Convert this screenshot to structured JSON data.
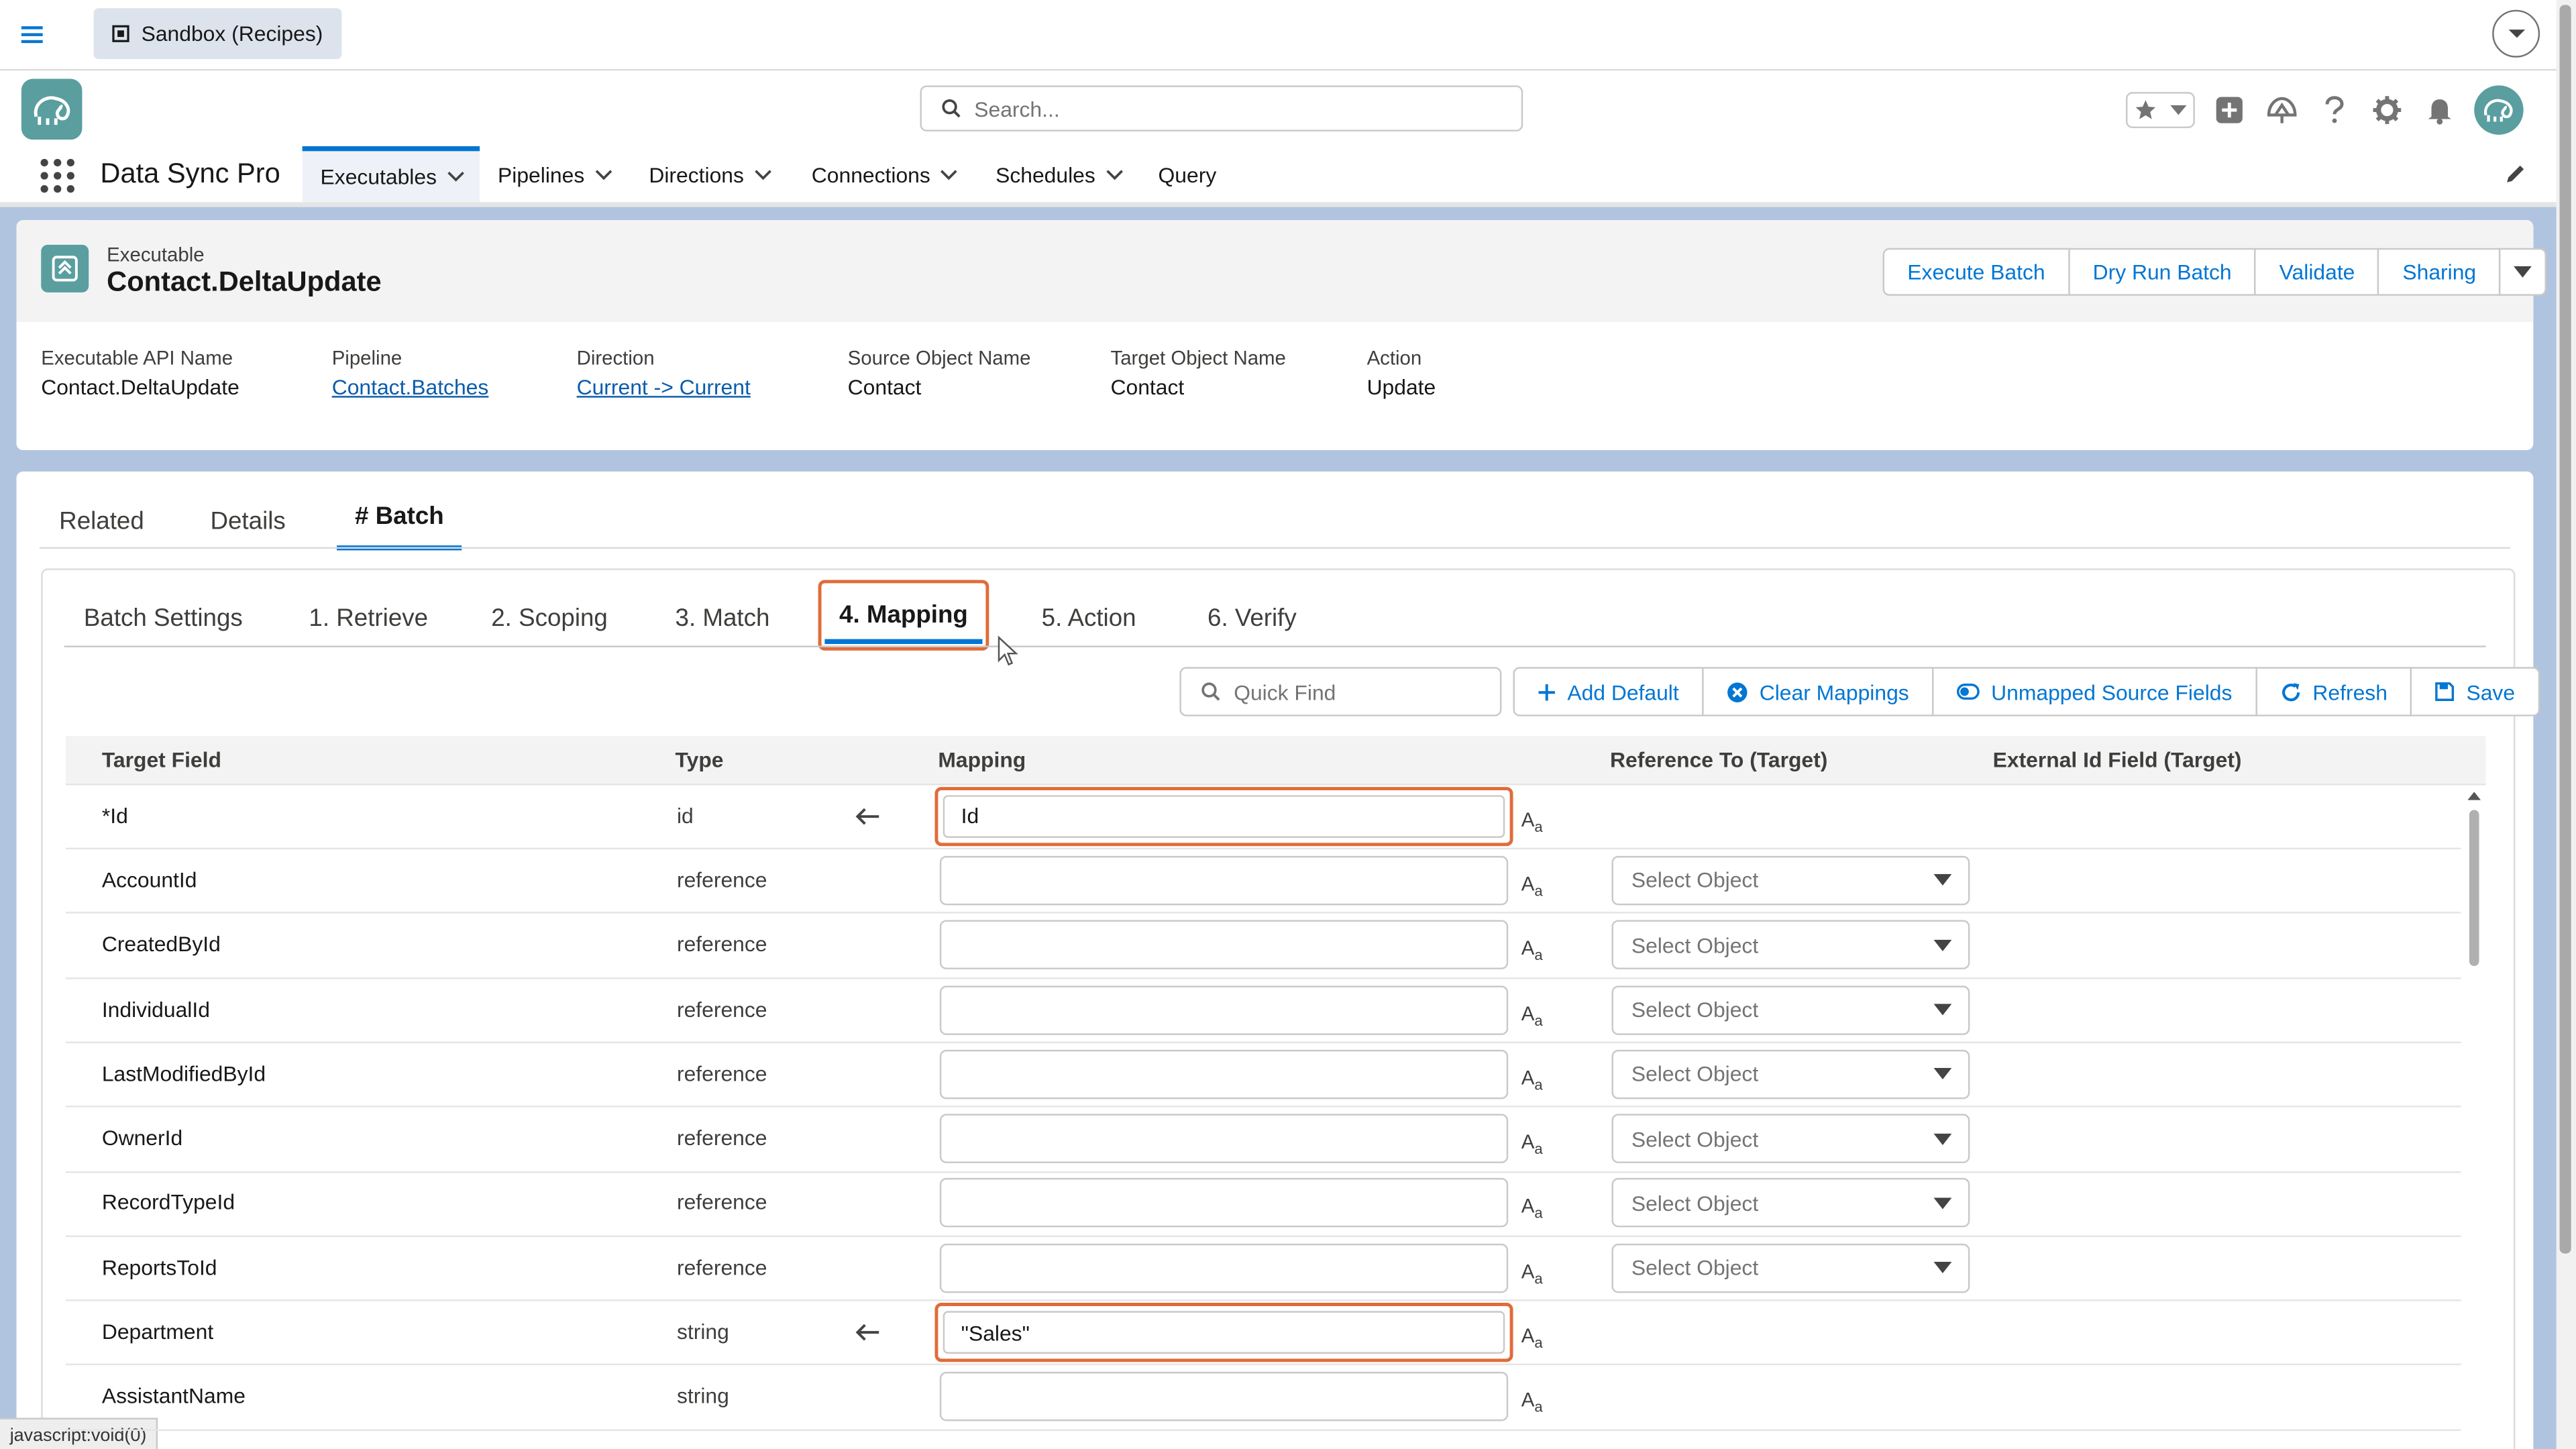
{
  "sandbox_label": "Sandbox (Recipes)",
  "search_placeholder": "Search...",
  "app_name": "Data Sync Pro",
  "nav": {
    "executables": "Executables",
    "pipelines": "Pipelines",
    "directions": "Directions",
    "connections": "Connections",
    "schedules": "Schedules",
    "query": "Query"
  },
  "record": {
    "type": "Executable",
    "title": "Contact.DeltaUpdate",
    "actions": [
      "Execute Batch",
      "Dry Run Batch",
      "Validate",
      "Sharing"
    ],
    "highlights": [
      {
        "label": "Executable API Name",
        "value": "Contact.DeltaUpdate"
      },
      {
        "label": "Pipeline",
        "value": "Contact.Batches"
      },
      {
        "label": "Direction",
        "value": "Current -> Current"
      },
      {
        "label": "Source Object Name",
        "value": "Contact"
      },
      {
        "label": "Target Object Name",
        "value": "Contact"
      },
      {
        "label": "Action",
        "value": "Update"
      }
    ]
  },
  "tabs": [
    "Related",
    "Details",
    "# Batch"
  ],
  "subtabs": [
    "Batch Settings",
    "1. Retrieve",
    "2. Scoping",
    "3. Match",
    "4. Mapping",
    "5. Action",
    "6. Verify"
  ],
  "quickfind_placeholder": "Quick Find",
  "toolbar": [
    "Add Default",
    "Clear Mappings",
    "Unmapped Source Fields",
    "Refresh",
    "Save"
  ],
  "columns": [
    "Target Field",
    "Type",
    "Mapping",
    "Reference To (Target)",
    "External Id Field (Target)"
  ],
  "select_placeholder": "Select Object",
  "aa_label": "A",
  "aa_sub": "a",
  "rows": [
    {
      "field": "*Id",
      "type": "id",
      "mapping": "Id"
    },
    {
      "field": "AccountId",
      "type": "reference",
      "mapping": ""
    },
    {
      "field": "CreatedById",
      "type": "reference",
      "mapping": ""
    },
    {
      "field": "IndividualId",
      "type": "reference",
      "mapping": ""
    },
    {
      "field": "LastModifiedById",
      "type": "reference",
      "mapping": ""
    },
    {
      "field": "OwnerId",
      "type": "reference",
      "mapping": ""
    },
    {
      "field": "RecordTypeId",
      "type": "reference",
      "mapping": ""
    },
    {
      "field": "ReportsToId",
      "type": "reference",
      "mapping": ""
    },
    {
      "field": "Department",
      "type": "string",
      "mapping": "\"Sales\""
    },
    {
      "field": "AssistantName",
      "type": "string",
      "mapping": ""
    }
  ],
  "status_text": "javascript:void(0)",
  "colors": {
    "accent": "#0176d3",
    "highlight": "#e06c3a",
    "brand": "#5a9ea0"
  }
}
